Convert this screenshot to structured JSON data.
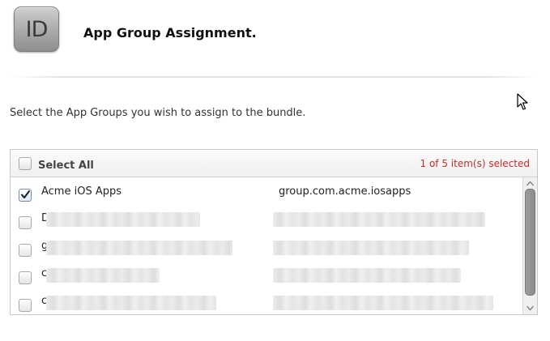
{
  "header": {
    "icon_text": "ID",
    "title": "App Group Assignment."
  },
  "instructions": "Select the App Groups you wish to assign to the bundle.",
  "panel": {
    "select_all_label": "Select All",
    "select_all_checked": false,
    "selected_count": "1 of 5 item(s) selected",
    "accent_color": "#c62b2b",
    "items": [
      {
        "name": "Acme iOS Apps",
        "identifier": "group.com.acme.iosapps",
        "checked": true,
        "redacted": false
      },
      {
        "name": "D",
        "identifier": "",
        "checked": false,
        "redacted": true
      },
      {
        "name": "g",
        "identifier": "",
        "checked": false,
        "redacted": true
      },
      {
        "name": "c",
        "identifier": "",
        "checked": false,
        "redacted": true
      },
      {
        "name": "c",
        "identifier": "",
        "checked": false,
        "redacted": true
      }
    ]
  },
  "icons": {
    "app_icon": "id-badge-icon",
    "cursor": "mouse-pointer-icon",
    "check": "checkmark-icon",
    "scroll_up": "chevron-up-icon",
    "scroll_down": "chevron-down-icon"
  }
}
